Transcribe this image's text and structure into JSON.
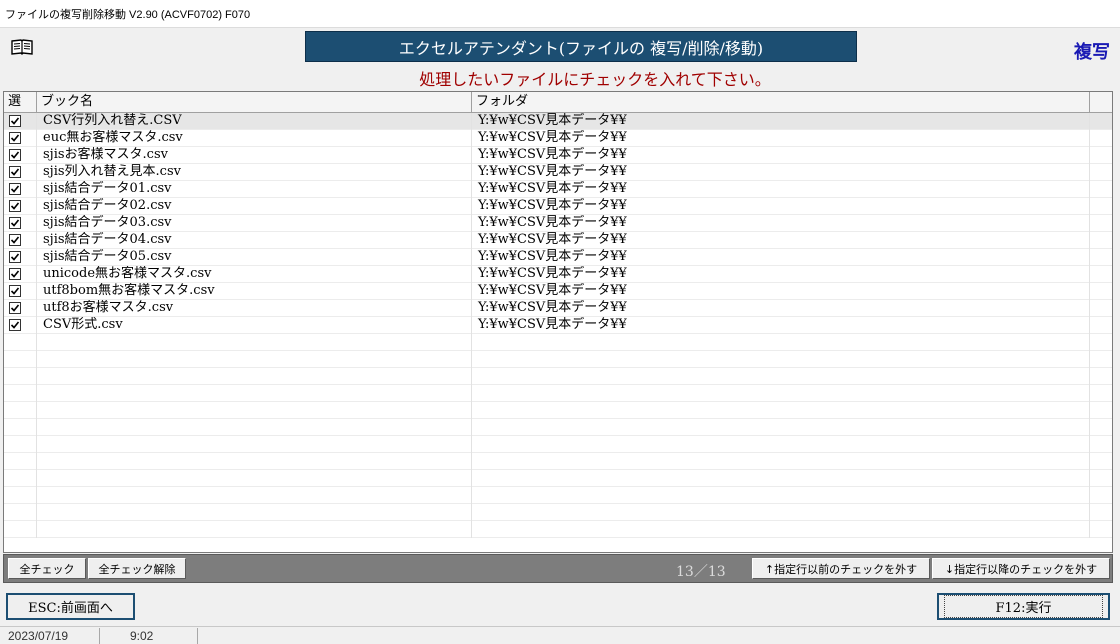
{
  "window": {
    "title": "ファイルの複写削除移動 V2.90 (ACVF0702)  F070"
  },
  "header": {
    "banner": "エクセルアテンダント(ファイルの 複写/削除/移動)",
    "mode": "複写",
    "instruction": "処理したいファイルにチェックを入れて下さい。",
    "icon": "book-icon"
  },
  "grid": {
    "columns": [
      "選",
      "ブック名",
      "フォルダ"
    ],
    "rows": [
      {
        "checked": true,
        "book": "CSV行列入れ替え.CSV",
        "folder": "Y:¥w¥CSV見本データ¥¥"
      },
      {
        "checked": true,
        "book": "euc無お客様マスタ.csv",
        "folder": "Y:¥w¥CSV見本データ¥¥"
      },
      {
        "checked": true,
        "book": "sjisお客様マスタ.csv",
        "folder": "Y:¥w¥CSV見本データ¥¥"
      },
      {
        "checked": true,
        "book": "sjis列入れ替え見本.csv",
        "folder": "Y:¥w¥CSV見本データ¥¥"
      },
      {
        "checked": true,
        "book": "sjis結合データ01.csv",
        "folder": "Y:¥w¥CSV見本データ¥¥"
      },
      {
        "checked": true,
        "book": "sjis結合データ02.csv",
        "folder": "Y:¥w¥CSV見本データ¥¥"
      },
      {
        "checked": true,
        "book": "sjis結合データ03.csv",
        "folder": "Y:¥w¥CSV見本データ¥¥"
      },
      {
        "checked": true,
        "book": "sjis結合データ04.csv",
        "folder": "Y:¥w¥CSV見本データ¥¥"
      },
      {
        "checked": true,
        "book": "sjis結合データ05.csv",
        "folder": "Y:¥w¥CSV見本データ¥¥"
      },
      {
        "checked": true,
        "book": "unicode無お客様マスタ.csv",
        "folder": "Y:¥w¥CSV見本データ¥¥"
      },
      {
        "checked": true,
        "book": "utf8bom無お客様マスタ.csv",
        "folder": "Y:¥w¥CSV見本データ¥¥"
      },
      {
        "checked": true,
        "book": "utf8お客様マスタ.csv",
        "folder": "Y:¥w¥CSV見本データ¥¥"
      },
      {
        "checked": true,
        "book": "CSV形式.csv",
        "folder": "Y:¥w¥CSV見本データ¥¥"
      }
    ],
    "selected_index": 0
  },
  "toolbar": {
    "check_all": "全チェック",
    "uncheck_all": "全チェック解除",
    "count": "13／13",
    "uncheck_before": "↑指定行以前のチェックを外す",
    "uncheck_after": "↓指定行以降のチェックを外す"
  },
  "actions": {
    "back": "ESC:前画面へ",
    "execute": "F12:実行"
  },
  "status": {
    "date": "2023/07/19",
    "time": "9:02"
  },
  "colors": {
    "banner_bg": "#1c4e72",
    "mode_text": "#1a1ab4",
    "instruction_text": "#a00000",
    "toolbar_bg": "#7d7d7d"
  }
}
